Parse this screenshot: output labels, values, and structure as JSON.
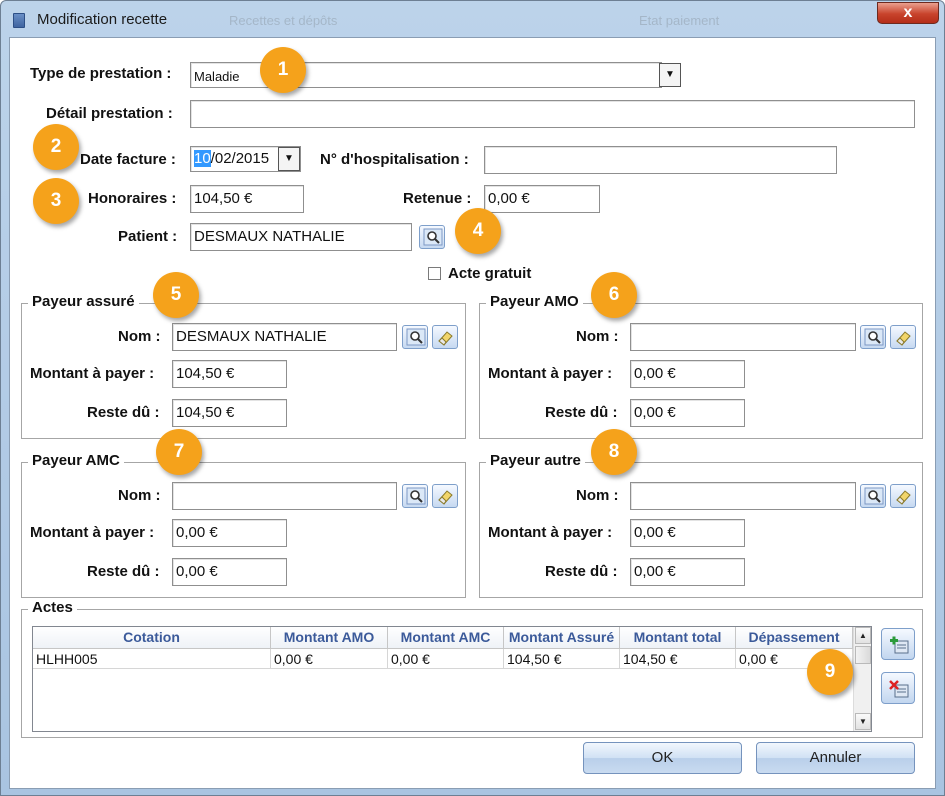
{
  "window": {
    "title": "Modification recette",
    "close_glyph": "x",
    "background_items": [
      "Recettes et dépôts",
      "Etat paiement"
    ]
  },
  "form": {
    "type_prestation": {
      "label": "Type de prestation :",
      "value": "Maladie"
    },
    "detail_prestation": {
      "label": "Détail prestation :",
      "value": ""
    },
    "date_facture": {
      "label": "Date facture :",
      "value_selected": "10",
      "value_rest": "/02/2015"
    },
    "hospitalisation": {
      "label": "N° d'hospitalisation :",
      "value": ""
    },
    "honoraires": {
      "label": "Honoraires :",
      "value": "104,50 €"
    },
    "retenue": {
      "label": "Retenue :",
      "value": "0,00 €"
    },
    "patient": {
      "label": "Patient :",
      "value": "DESMAUX NATHALIE"
    },
    "acte_gratuit": {
      "label": "Acte gratuit",
      "checked": false
    }
  },
  "payeurs": {
    "assure": {
      "title": "Payeur assuré",
      "nom_label": "Nom :",
      "nom": "DESMAUX NATHALIE",
      "montant_label": "Montant à payer :",
      "montant": "104,50 €",
      "reste_label": "Reste dû :",
      "reste": "104,50 €"
    },
    "amo": {
      "title": "Payeur AMO",
      "nom_label": "Nom :",
      "nom": "",
      "montant_label": "Montant à payer :",
      "montant": "0,00 €",
      "reste_label": "Reste dû :",
      "reste": "0,00 €"
    },
    "amc": {
      "title": "Payeur AMC",
      "nom_label": "Nom :",
      "nom": "",
      "montant_label": "Montant à payer :",
      "montant": "0,00 €",
      "reste_label": "Reste dû :",
      "reste": "0,00 €"
    },
    "autre": {
      "title": "Payeur autre",
      "nom_label": "Nom :",
      "nom": "",
      "montant_label": "Montant à payer :",
      "montant": "0,00 €",
      "reste_label": "Reste dû :",
      "reste": "0,00 €"
    }
  },
  "actes": {
    "title": "Actes",
    "columns": [
      "Cotation",
      "Montant AMO",
      "Montant AMC",
      "Montant Assuré",
      "Montant total",
      "Dépassement"
    ],
    "rows": [
      [
        "HLHH005",
        "0,00 €",
        "0,00 €",
        "104,50 €",
        "104,50 €",
        "0,00 €"
      ]
    ]
  },
  "buttons": {
    "ok": "OK",
    "cancel": "Annuler"
  },
  "badges": [
    "1",
    "2",
    "3",
    "4",
    "5",
    "6",
    "7",
    "8",
    "9"
  ],
  "colors": {
    "badge": "#f5a21b",
    "header_text": "#3b5a9a",
    "selection": "#3399ff"
  },
  "icons": [
    "search-icon",
    "eraser-icon",
    "add-row-icon",
    "delete-row-icon"
  ]
}
